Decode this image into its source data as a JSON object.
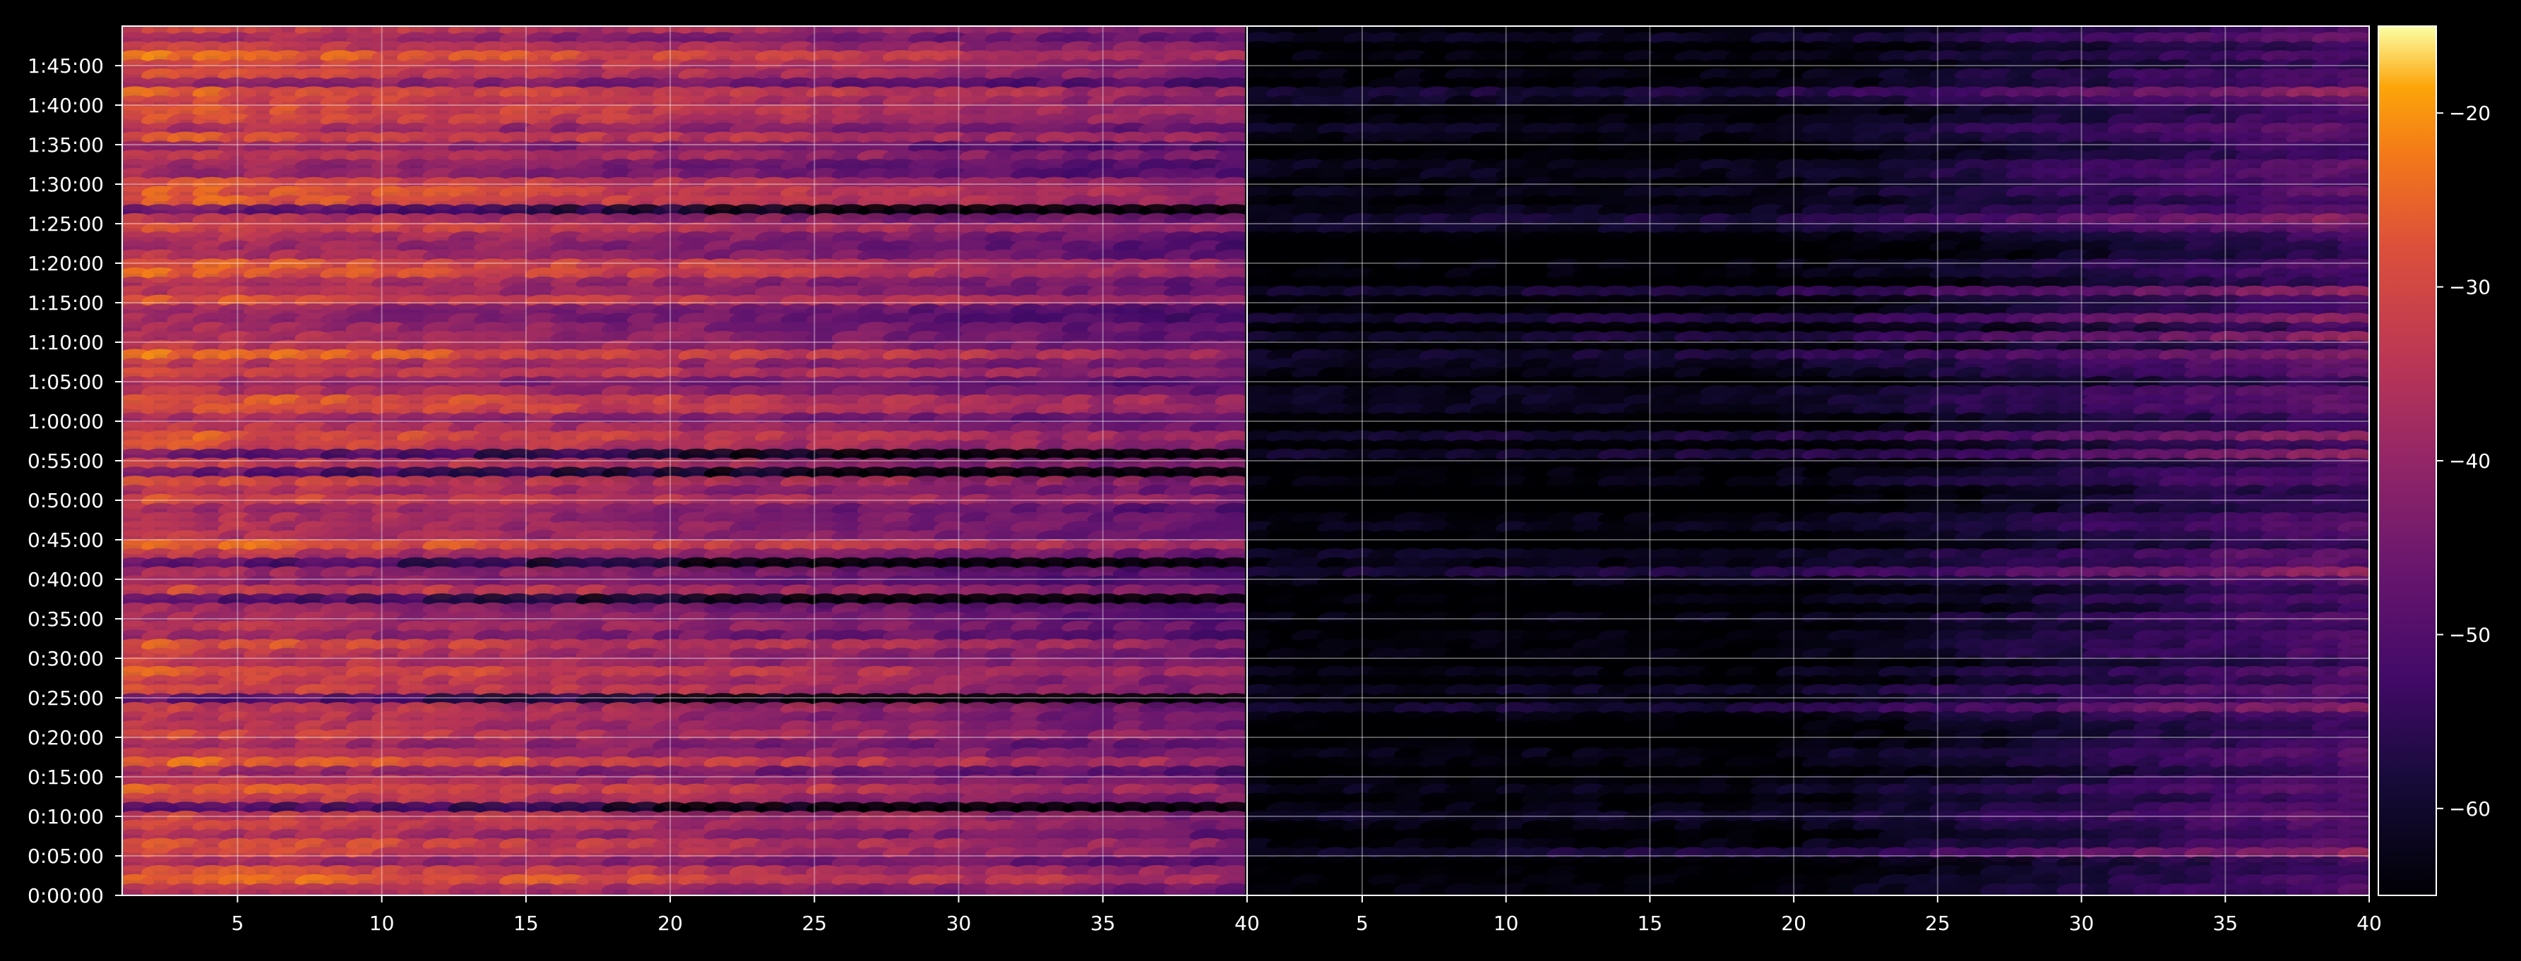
{
  "chart_data": {
    "type": "heatmap",
    "title": "",
    "panels": [
      {
        "name": "",
        "x_range": [
          1,
          40
        ],
        "x_ticks": [
          5,
          10,
          15,
          20,
          25,
          30,
          35,
          40
        ],
        "level": "high"
      },
      {
        "name": "",
        "x_range": [
          1,
          40
        ],
        "x_ticks": [
          5,
          10,
          15,
          20,
          25,
          30,
          35,
          40
        ],
        "level": "low"
      }
    ],
    "y_ticks": [
      "0:00:00",
      "0:05:00",
      "0:10:00",
      "0:15:00",
      "0:20:00",
      "0:25:00",
      "0:30:00",
      "0:35:00",
      "0:40:00",
      "0:45:00",
      "0:50:00",
      "0:55:00",
      "1:00:00",
      "1:05:00",
      "1:10:00",
      "1:15:00",
      "1:20:00",
      "1:25:00",
      "1:30:00",
      "1:35:00",
      "1:40:00",
      "1:45:00"
    ],
    "y_range_minutes": [
      0,
      110
    ],
    "colorbar": {
      "colormap": "inferno",
      "min": -65,
      "max": -15,
      "ticks": [
        -20,
        -30,
        -40,
        -50,
        -60
      ]
    },
    "grid": true,
    "legend": "none"
  }
}
